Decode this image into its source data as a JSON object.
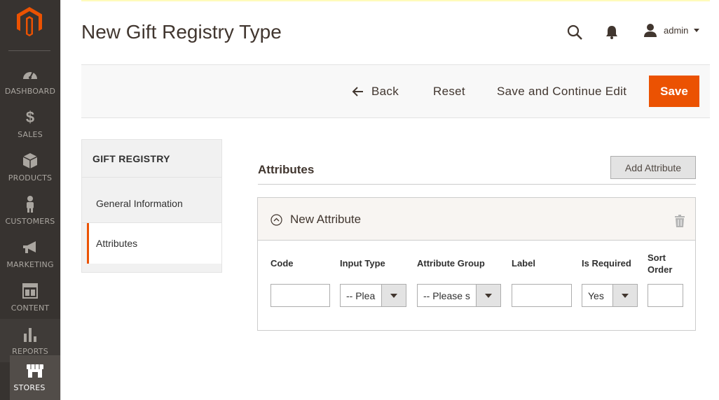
{
  "sidebar": {
    "logo_icon": "magento-logo-icon",
    "items": [
      {
        "label": "DASHBOARD",
        "icon": "dashboard-icon"
      },
      {
        "label": "SALES",
        "icon": "dollar-icon"
      },
      {
        "label": "PRODUCTS",
        "icon": "cube-icon"
      },
      {
        "label": "CUSTOMERS",
        "icon": "person-icon"
      },
      {
        "label": "MARKETING",
        "icon": "megaphone-icon"
      },
      {
        "label": "CONTENT",
        "icon": "layout-icon"
      },
      {
        "label": "REPORTS",
        "icon": "bar-chart-icon"
      },
      {
        "label": "STORES",
        "icon": "store-icon"
      }
    ],
    "active": "STORES"
  },
  "header": {
    "title": "New Gift Registry Type",
    "user": "admin"
  },
  "actions": {
    "back": "Back",
    "reset": "Reset",
    "save_continue": "Save and Continue Edit",
    "save": "Save"
  },
  "tabs": {
    "title": "GIFT REGISTRY",
    "items": [
      {
        "label": "General Information"
      },
      {
        "label": "Attributes"
      }
    ],
    "active": "Attributes"
  },
  "attributes": {
    "section_title": "Attributes",
    "add_button": "Add Attribute",
    "new_attribute": {
      "title": "New Attribute",
      "columns": {
        "code": "Code",
        "input_type": "Input Type",
        "attribute_group": "Attribute Group",
        "label": "Label",
        "is_required": "Is Required",
        "sort_order_1": "Sort",
        "sort_order_2": "Order"
      },
      "values": {
        "code": "",
        "input_type": "-- Plea",
        "attribute_group": "-- Please s",
        "label": "",
        "is_required": "Yes",
        "sort_order": ""
      }
    }
  },
  "colors": {
    "accent": "#eb5202",
    "sidebar_bg": "#373330",
    "sidebar_active": "#524d49"
  }
}
